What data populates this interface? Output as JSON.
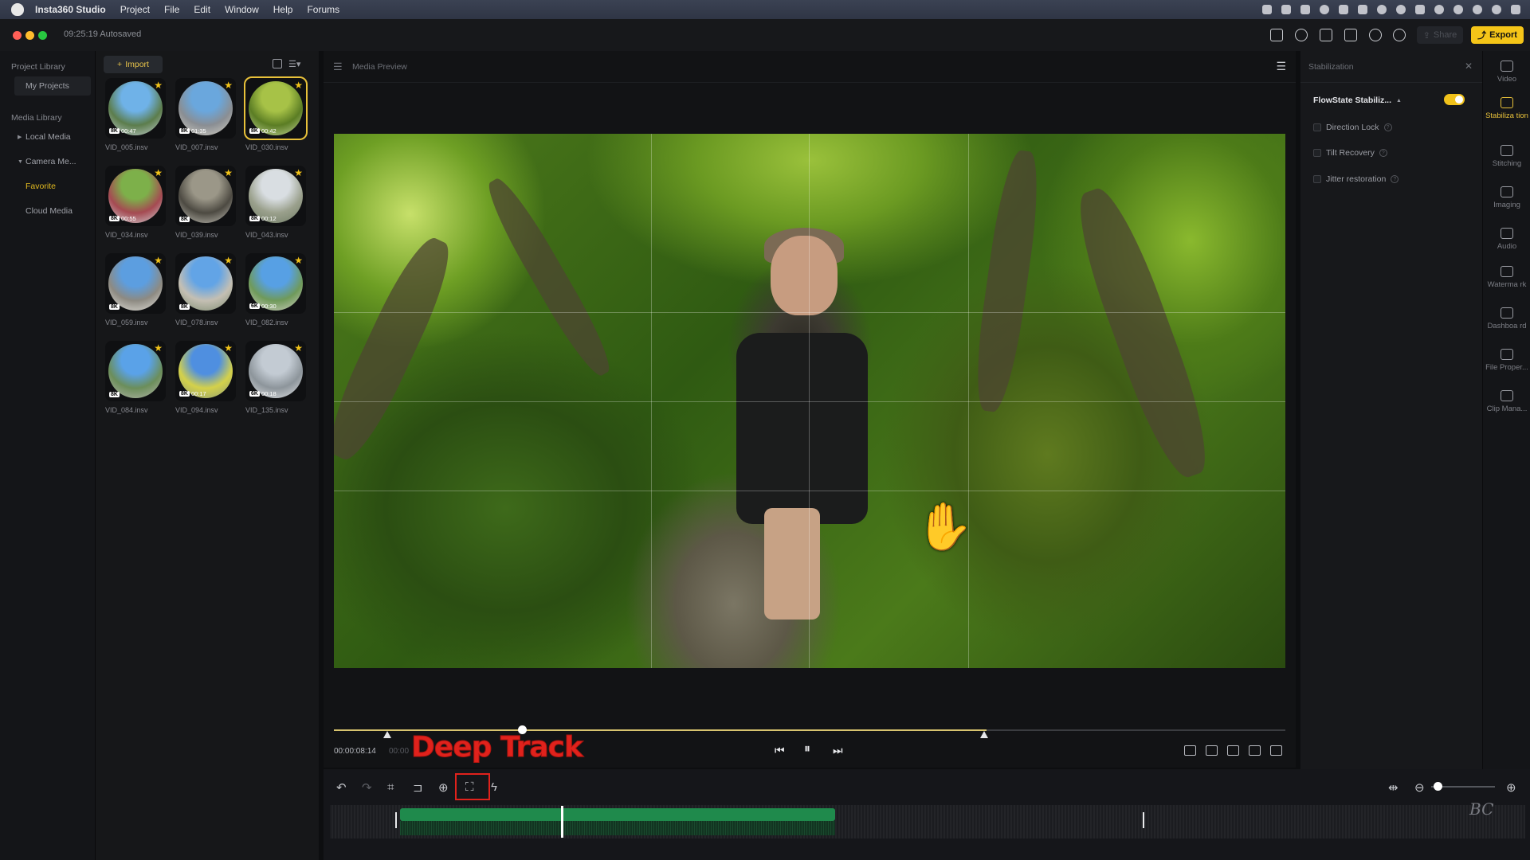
{
  "menubar": {
    "app_name": "Insta360 Studio",
    "items": [
      "Project",
      "File",
      "Edit",
      "Window",
      "Help",
      "Forums"
    ]
  },
  "titlebar": {
    "autosave": "09:25:19 Autosaved",
    "share_label": "Share",
    "export_label": "Export"
  },
  "leftnav": {
    "project_library": "Project Library",
    "my_projects": "My Projects",
    "media_library": "Media Library",
    "local_media": "Local Media",
    "camera_media": "Camera Me...",
    "favorite": "Favorite",
    "cloud_media": "Cloud Media"
  },
  "media": {
    "import_label": "Import",
    "items": [
      {
        "name": "VID_005.insv",
        "res": "8K",
        "dur": "00:47"
      },
      {
        "name": "VID_007.insv",
        "res": "8K",
        "dur": "01:35"
      },
      {
        "name": "VID_030.insv",
        "res": "8K",
        "dur": "00:42",
        "selected": true
      },
      {
        "name": "VID_034.insv",
        "res": "8K",
        "dur": "00:55"
      },
      {
        "name": "VID_039.insv",
        "res": "8K",
        "dur": ""
      },
      {
        "name": "VID_043.insv",
        "res": "8K",
        "dur": "00:12"
      },
      {
        "name": "VID_059.insv",
        "res": "8K",
        "dur": ""
      },
      {
        "name": "VID_078.insv",
        "res": "8K",
        "dur": ""
      },
      {
        "name": "VID_082.insv",
        "res": "6K",
        "dur": "00:30"
      },
      {
        "name": "VID_084.insv",
        "res": "8K",
        "dur": ""
      },
      {
        "name": "VID_094.insv",
        "res": "8K",
        "dur": "00:17"
      },
      {
        "name": "VID_135.insv",
        "res": "6K",
        "dur": "00:18"
      }
    ]
  },
  "preview": {
    "title": "Media Preview",
    "time_current": "00:00:08:14",
    "time_total": "00:00",
    "overlay_text": "Deep Track",
    "progress": 0.2
  },
  "stabilization": {
    "panel_title": "Stabilization",
    "flowstate_label": "FlowState Stabiliz...",
    "flowstate_on": true,
    "direction_lock": "Direction Lock",
    "tilt_recovery": "Tilt Recovery",
    "jitter_restoration": "Jitter restoration"
  },
  "rail": {
    "video": "Video",
    "stabilization": "Stabiliza tion",
    "stitching": "Stitching",
    "imaging": "Imaging",
    "audio": "Audio",
    "watermark": "Waterma rk",
    "dashboard": "Dashboa rd",
    "file_properties": "File Proper...",
    "clip_manager": "Clip Mana..."
  },
  "timeline": {
    "signature": "BC"
  },
  "colors": {
    "accent": "#f5c518",
    "overlay_red": "#e0221c",
    "clip_green": "#1f8a4c"
  }
}
